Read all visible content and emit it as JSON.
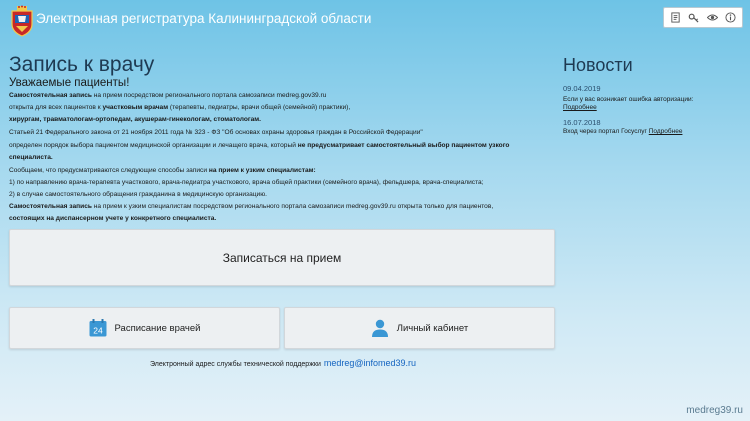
{
  "header": {
    "title": "Электронная регистратура Калининградской области",
    "toolbar": [
      {
        "icon": "document-icon"
      },
      {
        "icon": "key-icon"
      },
      {
        "icon": "eye-icon"
      },
      {
        "icon": "info-icon"
      }
    ]
  },
  "main": {
    "title": "Запись к врачу",
    "greeting": "Уважаемые пациенты!",
    "p1_bold": "Самостоятельная запись",
    "p1_text": " на прием посредством регионального портала самозаписи medreg.gov39.ru",
    "p2_text": "открыта для всех пациентов к ",
    "p2_bold": "участковым врачам",
    "p2_tail": " (терапевты, педиатры, врачи общей (семейной) практики),",
    "p3_bold": "хирургам, травматологам-ортопедам, акушерам-гинекологам, стоматологам.",
    "p4_text": "Статьей 21 Федерального закона от 21 ноября 2011 года № 323 - ФЗ \"Об основах охраны здоровья граждан в Российской Федерации\"",
    "p5_text": "определен порядок выбора пациентом медицинской организации и лечащего врача, который ",
    "p5_bold": "не предусматривает самостоятельный выбор пациентом узкого",
    "p6_bold": "специалиста.",
    "p7_text": "Сообщаем, что предусматриваются следующие способы записи ",
    "p7_bold": "на прием к узким специалистам:",
    "p8_text": "1) по направлению врача-терапевта участкового, врача-педиатра участкового, врача общей практики (семейного врача), фельдшера, врача-специалиста;",
    "p9_text": "2) в случае самостоятельного обращения гражданина в медицинскую организацию.",
    "p10_bold": "Самостоятельная запись",
    "p10_text": " на прием к узким специалистам посредством регионального портала самозаписи medreg.gov39.ru открыта только для пациентов,",
    "p11_bold": "состоящих на диспансерном учете у конкретного специалиста.",
    "book_button": "Записаться на прием",
    "schedule_button": "Расписание врачей",
    "schedule_icon_day": "24",
    "cabinet_button": "Личный кабинет",
    "support_text": "Электронный адрес службы технической поддержки",
    "support_email": "medreg@infomed39.ru"
  },
  "news": {
    "title": "Новости",
    "items": [
      {
        "date": "09.04.2019",
        "text": "Если у вас возникает ошибка авторизации:",
        "link": "Подробнее"
      },
      {
        "date": "16.07.2018",
        "text": "Вход через портал Госуслуг",
        "link": "Подробнее"
      }
    ]
  },
  "watermark": "medreg39.ru",
  "colors": {
    "accent_link": "#1565c0",
    "heading": "#1e3a52",
    "icon_blue": "#3a97d4"
  }
}
